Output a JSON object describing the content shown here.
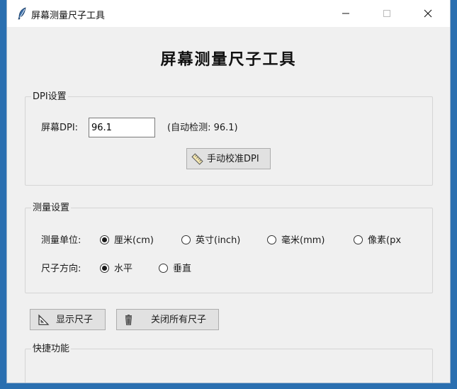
{
  "window": {
    "title": "屏幕测量尺子工具"
  },
  "heading": "屏幕测量尺子工具",
  "dpi_group": {
    "legend": "DPI设置",
    "label": "屏幕DPI:",
    "value": "96.1",
    "detected": "(自动检测: 96.1)",
    "calibrate_button": "手动校准DPI"
  },
  "measure_group": {
    "legend": "测量设置",
    "unit_label": "测量单位:",
    "units": [
      {
        "label": "厘米(cm)",
        "checked": true
      },
      {
        "label": "英寸(inch)",
        "checked": false
      },
      {
        "label": "毫米(mm)",
        "checked": false
      },
      {
        "label": "像素(px",
        "checked": false
      }
    ],
    "direction_label": "尺子方向:",
    "directions": [
      {
        "label": "水平",
        "checked": true
      },
      {
        "label": "垂直",
        "checked": false
      }
    ]
  },
  "actions": {
    "show_ruler": "显示尺子",
    "close_all": "关闭所有尺子"
  },
  "quick_group": {
    "legend": "快捷功能"
  }
}
